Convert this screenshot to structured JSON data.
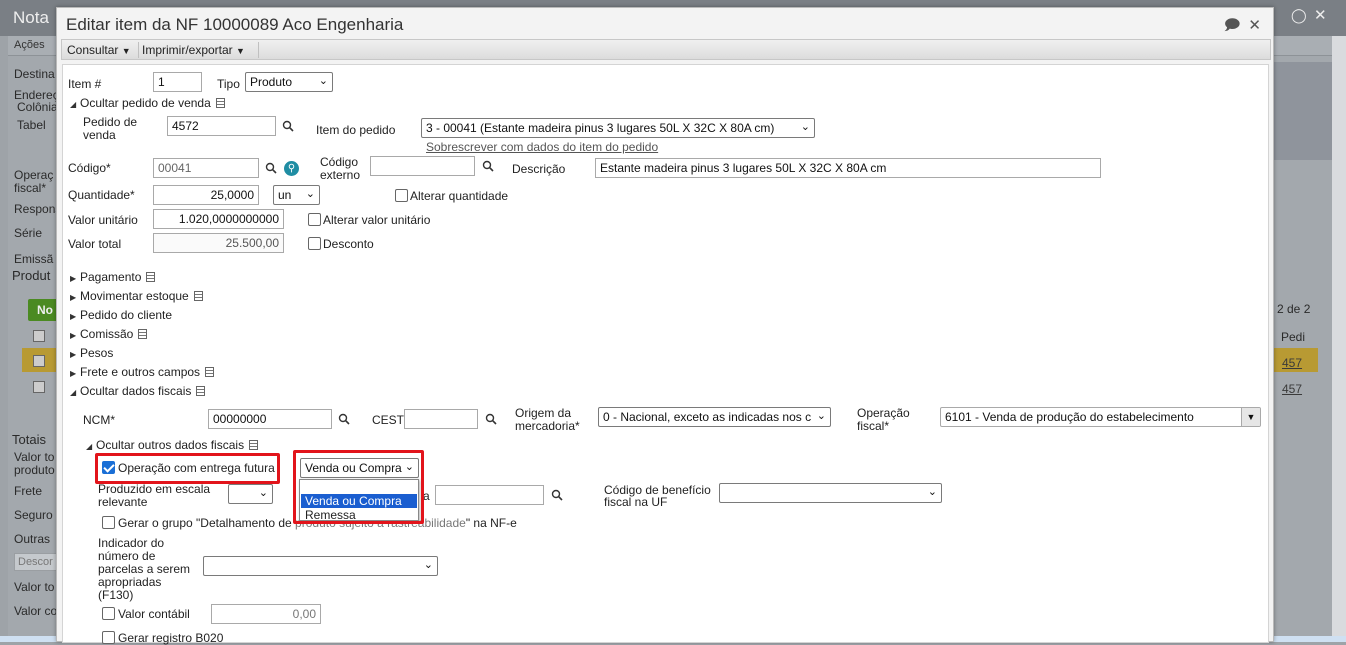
{
  "background": {
    "title": "Nota",
    "menu": "Ações",
    "labels": {
      "destinatario": "Destina",
      "endereco": "Endereç",
      "colonia": "Colônia",
      "tabela": "Tabel",
      "operacao": "Operaç",
      "fiscal": "fiscal*",
      "responsavel": "Respons",
      "serie": "Série",
      "emissao": "Emissã",
      "produtos": "Produt",
      "novo": "No",
      "totais": "Totais",
      "valor_total": "Valor to",
      "produtos2": "produto",
      "frete": "Frete",
      "seguro": "Seguro",
      "outras": "Outras",
      "descontos": "Descor",
      "valor_total2": "Valor to",
      "valor_co": "Valor co",
      "pagination": "2 de 2",
      "pedi": "Pedi",
      "row1": "457",
      "row2": "457"
    }
  },
  "modal": {
    "title": "Editar item da NF 10000089 Aco Engenharia",
    "toolbar": {
      "consultar": "Consultar",
      "imprimir": "Imprimir/exportar"
    },
    "item_label": "Item #",
    "item_value": "1",
    "tipo_label": "Tipo",
    "tipo_value": "Produto",
    "sections": {
      "ocultar_pedido": "Ocultar pedido de venda",
      "pagamento": "Pagamento",
      "movimentar_estoque": "Movimentar estoque",
      "pedido_cliente": "Pedido do cliente",
      "comissao": "Comissão",
      "pesos": "Pesos",
      "frete": "Frete e outros campos",
      "ocultar_fiscais": "Ocultar dados fiscais",
      "ocultar_outros_fiscais": "Ocultar outros dados fiscais"
    },
    "pedido": {
      "label": "Pedido de venda",
      "label_l1": "Pedido de",
      "label_l2": "venda",
      "value": "4572",
      "item_label": "Item do pedido",
      "item_value": "3 - 00041 (Estante madeira pinus 3 lugares 50L X 32C X 80A cm)",
      "overwrite_link": "Sobrescrever com dados do item do pedido"
    },
    "codigo": {
      "label": "Código*",
      "value": "00041",
      "externo_l1": "Código",
      "externo_l2": "externo",
      "externo_value": "",
      "descricao_label": "Descrição",
      "descricao_value": "Estante madeira pinus 3 lugares 50L X 32C X 80A cm"
    },
    "quantidade": {
      "label": "Quantidade*",
      "value": "25,0000",
      "unit": "un",
      "alterar": "Alterar quantidade"
    },
    "valor_unitario": {
      "label": "Valor unitário",
      "value": "1.020,0000000000",
      "alterar": "Alterar valor unitário"
    },
    "valor_total": {
      "label": "Valor total",
      "value": "25.500,00",
      "desconto": "Desconto"
    },
    "fiscal": {
      "ncm_label": "NCM*",
      "ncm_value": "00000000",
      "cest_label": "CEST",
      "cest_value": "",
      "origem_l1": "Origem da",
      "origem_l2": "mercadoria*",
      "origem_value": "0 - Nacional, exceto as indicadas nos c",
      "operacao_l1": "Operação",
      "operacao_l2": "fiscal*",
      "operacao_value": "6101 - Venda de produção do estabelecimento"
    },
    "outros": {
      "entrega_futura": "Operação com entrega futura",
      "entrega_futura_checked": true,
      "tipo_select": "Venda ou Compra",
      "dropdown_options": [
        "Venda ou Compra",
        "Remessa"
      ],
      "produzido_l1": "Produzido em escala",
      "produzido_l2": "relevante",
      "produzido_value": "",
      "cnpj_suffix": "a",
      "cnpj_value": "",
      "beneficio_l1": "Código de benefício",
      "beneficio_l2": "fiscal na UF",
      "beneficio_value": "",
      "rastreabilidade_a": "Gerar o grupo \"Detalhamento de",
      "rastreabilidade_b": "\" na NF-e",
      "rastreabilidade_hidden": "produto sujeito a rastreabilidade",
      "indicador_l1": "Indicador do",
      "indicador_l2": "número de",
      "indicador_l3": "parcelas a serem",
      "indicador_l4": "apropriadas",
      "indicador_l5": "(F130)",
      "indicador_value": "",
      "valor_contabil": "Valor contábil",
      "valor_contabil_value": "0,00",
      "gerar_registro": "Gerar registro B020"
    }
  },
  "colors": {
    "highlight": "#e2141b",
    "selected_option": "#1a5ed0",
    "checkbox": "#1a6fd6"
  }
}
